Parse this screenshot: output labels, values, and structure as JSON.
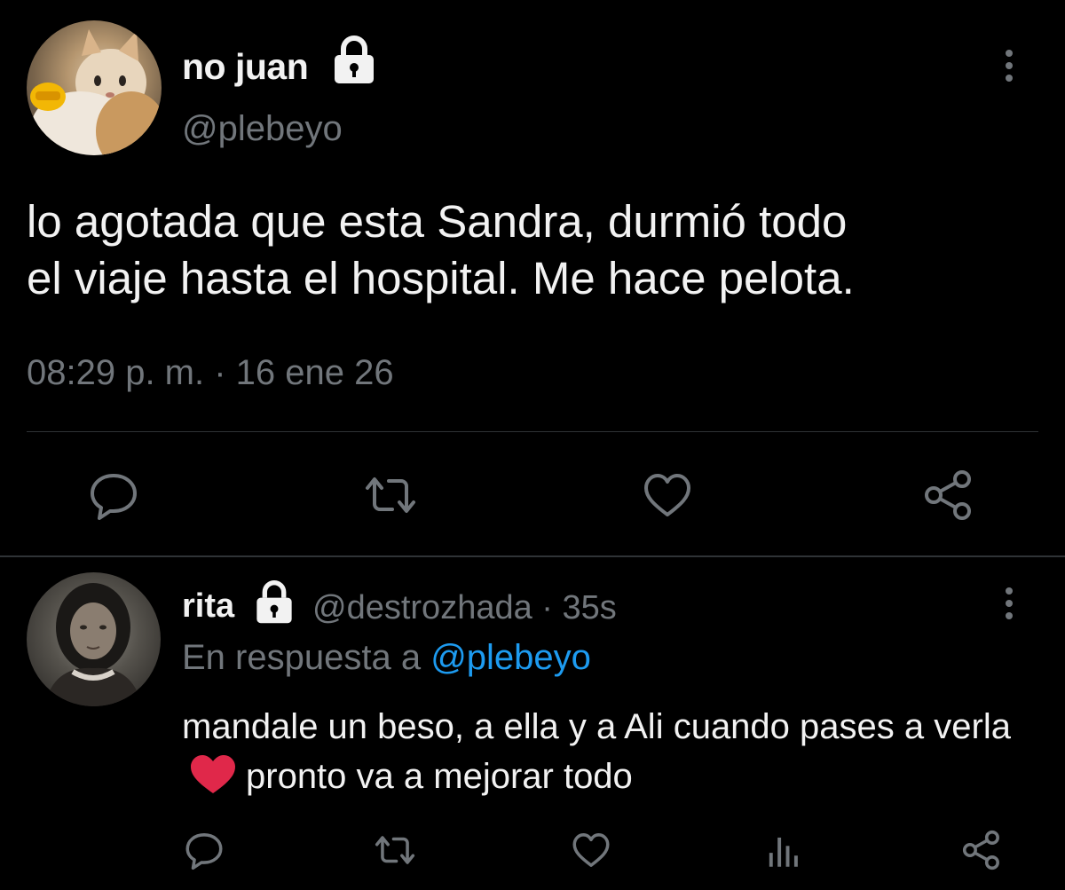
{
  "main_tweet": {
    "author": {
      "display_name": "no juan",
      "handle": "@plebeyo",
      "protected_icon": "lock-icon",
      "avatar": "cat-avatar"
    },
    "text": "lo agotada que esta Sandra, durmió todo\nel viaje hasta el hospital. Me hace pelota.",
    "timestamp": "08:29 p. m. · 16 ene 26",
    "actions": [
      "reply-icon",
      "retweet-icon",
      "like-icon",
      "share-icon"
    ],
    "menu_icon": "more-vertical-icon"
  },
  "reply_tweet": {
    "author": {
      "display_name": "rita",
      "handle_time": "@destrozhada · 35s",
      "protected_icon": "lock-icon",
      "avatar": "woman-avatar"
    },
    "reply_context_prefix": "En respuesta a ",
    "reply_context_mention": "@plebeyo",
    "text_before_emoji": "mandale un beso, a ella y a Ali cuando pases a verla",
    "emoji": "red-heart-emoji",
    "text_after_emoji": "pronto va a mejorar todo",
    "actions": [
      "reply-icon",
      "retweet-icon",
      "like-icon",
      "stats-icon",
      "share-icon"
    ],
    "menu_icon": "more-vertical-icon"
  },
  "colors": {
    "background": "#000000",
    "text_primary": "#f2f2f2",
    "text_secondary": "#71767b",
    "link": "#1d9bf0",
    "divider": "#2f3336",
    "heart": "#e0284a"
  }
}
